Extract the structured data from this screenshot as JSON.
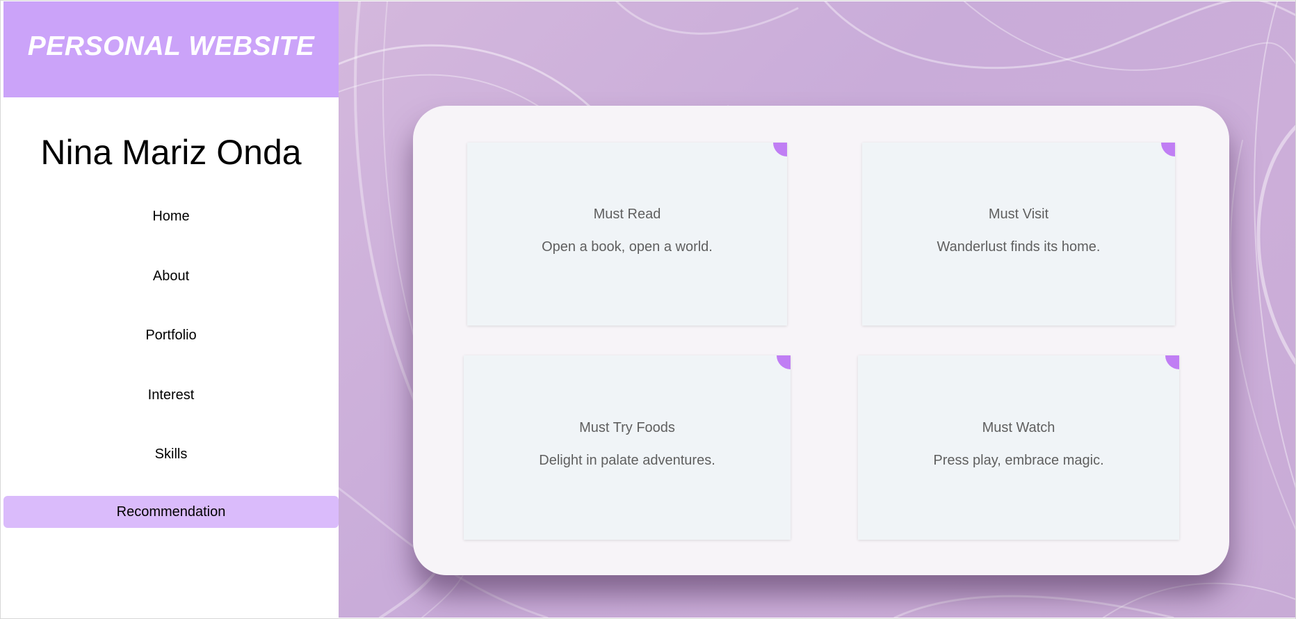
{
  "header": {
    "title": "PERSONAL WEBSITE"
  },
  "profile": {
    "name": "Nina Mariz Onda"
  },
  "nav": {
    "items": [
      {
        "label": "Home"
      },
      {
        "label": "About"
      },
      {
        "label": "Portfolio"
      },
      {
        "label": "Interest"
      },
      {
        "label": "Skills"
      },
      {
        "label": "Recommendation",
        "active": true
      }
    ]
  },
  "cards": [
    {
      "title": "Must Read",
      "text": "Open a book, open a world."
    },
    {
      "title": "Must Visit",
      "text": "Wanderlust finds its home."
    },
    {
      "title": "Must Try Foods",
      "text": "Delight in palate adventures."
    },
    {
      "title": "Must Watch",
      "text": "Press play, embrace magic."
    }
  ],
  "colors": {
    "header_bg": "#cba3f9",
    "active_nav_bg": "#dabbfb",
    "card_corner_accent": "#c07ef4",
    "main_bg": "#cbaed9"
  }
}
